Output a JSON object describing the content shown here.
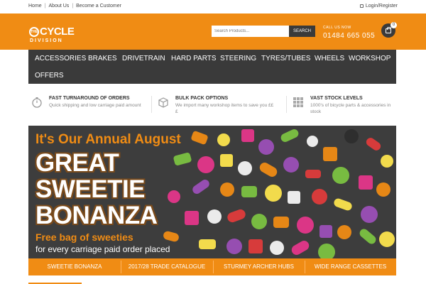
{
  "topbar": {
    "links": [
      "Home",
      "About Us",
      "Become a Customer"
    ],
    "login": "Login/Register"
  },
  "header": {
    "logo": {
      "the": "THE",
      "cycle": "CYCLE",
      "division": "DIVISION"
    },
    "search": {
      "placeholder": "Search Products...",
      "button": "SEARCH"
    },
    "call": {
      "label": "CALL US NOW",
      "number": "01484 665 055"
    },
    "cart": {
      "count": "0"
    }
  },
  "nav": {
    "items": [
      "ACCESSORIES",
      "BRAKES",
      "DRIVETRAIN",
      "HARD PARTS",
      "STEERING",
      "TYRES/TUBES",
      "WHEELS",
      "WORKSHOP",
      "OFFERS"
    ]
  },
  "features": [
    {
      "icon": "stopwatch-icon",
      "title": "FAST TURNAROUND OF ORDERS",
      "desc": "Quick shipping and low carriage paid amount"
    },
    {
      "icon": "box-icon",
      "title": "BULK PACK OPTIONS",
      "desc": "We import many workshop items to save you £££"
    },
    {
      "icon": "grid-icon",
      "title": "VAST STOCK LEVELS",
      "desc": "1000's of bicycle parts & accessories in stock"
    }
  ],
  "banner": {
    "headline": "It's Our Annual August",
    "line1": "GREAT",
    "line2": "SWEETIE",
    "line3": "BONANZA",
    "sub1": "Free bag of sweeties",
    "sub2": "for every carriage paid order placed"
  },
  "banner_tabs": [
    "SWEETIE BONANZA",
    "2017/28 TRADE CATALOGUE",
    "STURMEY ARCHER HUBS",
    "WIDE RANGE CASSETTES"
  ],
  "colors": {
    "brand_orange": "#f08c14",
    "dark": "#3a3a3a"
  }
}
